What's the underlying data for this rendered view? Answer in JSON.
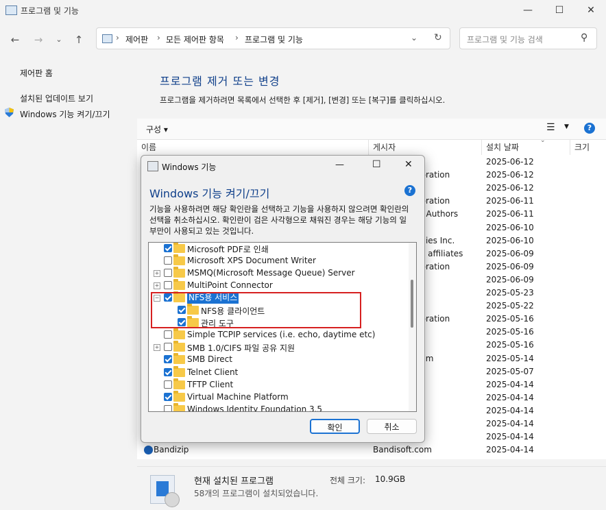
{
  "window": {
    "title": "프로그램 및 기능"
  },
  "nav": {
    "breadcrumb": [
      "제어판",
      "모든 제어판 항목",
      "프로그램 및 기능"
    ],
    "search_placeholder": "프로그램 및 기능 검색"
  },
  "left_panel": {
    "home": "제어판 홈",
    "updates": "설치된 업데이트 보기",
    "features": "Windows 기능 켜기/끄기"
  },
  "main": {
    "title": "프로그램 제거 또는 변경",
    "description": "프로그램을 제거하려면 목록에서 선택한 후 [제거], [변경] 또는 [복구]를 클릭하십시오.",
    "organize": "구성 ▾",
    "columns": {
      "name": "이름",
      "publisher": "게시자",
      "date": "설치 날짜",
      "size": "크기"
    },
    "rows": [
      {
        "publisher": "",
        "date": "2025-06-12"
      },
      {
        "publisher": "poration",
        "date": "2025-06-12"
      },
      {
        "publisher": "",
        "date": "2025-06-12"
      },
      {
        "publisher": "poration",
        "date": "2025-06-11"
      },
      {
        "publisher": "m Authors",
        "date": "2025-06-11"
      },
      {
        "publisher": "",
        "date": "2025-06-10"
      },
      {
        "publisher": "ogies Inc.",
        "date": "2025-06-10"
      },
      {
        "publisher": "its affiliates",
        "date": "2025-06-09"
      },
      {
        "publisher": "poration",
        "date": "2025-06-09"
      },
      {
        "publisher": "",
        "date": "2025-06-09"
      },
      {
        "publisher": "",
        "date": "2025-05-23"
      },
      {
        "publisher": "",
        "date": "2025-05-22"
      },
      {
        "publisher": "poration",
        "date": "2025-05-16"
      },
      {
        "publisher": "",
        "date": "2025-05-16"
      },
      {
        "publisher": "",
        "date": "2025-05-16"
      },
      {
        "publisher": "eam",
        "date": "2025-05-14"
      },
      {
        "publisher": "",
        "date": "2025-05-07"
      },
      {
        "publisher": "",
        "date": "2025-04-14"
      },
      {
        "publisher": "",
        "date": "2025-04-14"
      },
      {
        "publisher": "",
        "date": "2025-04-14"
      },
      {
        "publisher": "",
        "date": "2025-04-14"
      },
      {
        "publisher": "",
        "date": "2025-04-14"
      },
      {
        "name": "Bandizip",
        "publisher": "Bandisoft.com",
        "date": "2025-04-14"
      }
    ]
  },
  "status": {
    "title": "현재 설치된 프로그램",
    "total_label": "전체 크기:",
    "total_value": "10.9GB",
    "count_text": "58개의 프로그램이 설치되었습니다."
  },
  "dialog": {
    "title": "Windows 기능",
    "heading": "Windows 기능 켜기/끄기",
    "description": "기능을 사용하려면 해당 확인란을 선택하고 기능을 사용하지 않으려면 확인란의 선택을 취소하십시오. 확인란이 검은 사각형으로 채워진 경우는 해당 기능의 일부만이 사용되고 있는 것입니다.",
    "features": [
      {
        "label": "Microsoft PDF로 인쇄",
        "checked": true,
        "level": 0,
        "expander": ""
      },
      {
        "label": "Microsoft XPS Document Writer",
        "checked": false,
        "level": 0,
        "expander": ""
      },
      {
        "label": "MSMQ(Microsoft Message Queue) Server",
        "checked": false,
        "level": 0,
        "expander": "+"
      },
      {
        "label": "MultiPoint Connector",
        "checked": false,
        "level": 0,
        "expander": "+"
      },
      {
        "label": "NFS용 서비스",
        "checked": true,
        "level": 0,
        "expander": "−",
        "selected": true
      },
      {
        "label": "NFS용 클라이언트",
        "checked": true,
        "level": 1,
        "expander": ""
      },
      {
        "label": "관리 도구",
        "checked": true,
        "level": 1,
        "expander": ""
      },
      {
        "label": "Simple TCPIP services (i.e. echo, daytime etc)",
        "checked": false,
        "level": 0,
        "expander": ""
      },
      {
        "label": "SMB 1.0/CIFS 파일 공유 지원",
        "checked": false,
        "level": 0,
        "expander": "+"
      },
      {
        "label": "SMB Direct",
        "checked": true,
        "level": 0,
        "expander": ""
      },
      {
        "label": "Telnet Client",
        "checked": true,
        "level": 0,
        "expander": ""
      },
      {
        "label": "TFTP Client",
        "checked": false,
        "level": 0,
        "expander": ""
      },
      {
        "label": "Virtual Machine Platform",
        "checked": true,
        "level": 0,
        "expander": ""
      },
      {
        "label": "Windows Identity Foundation 3.5",
        "checked": false,
        "level": 0,
        "expander": ""
      }
    ],
    "ok": "확인",
    "cancel": "취소"
  },
  "colors": {
    "accent": "#1b72d2",
    "heading": "#0f3f8a",
    "highlight_border": "#d62020"
  }
}
